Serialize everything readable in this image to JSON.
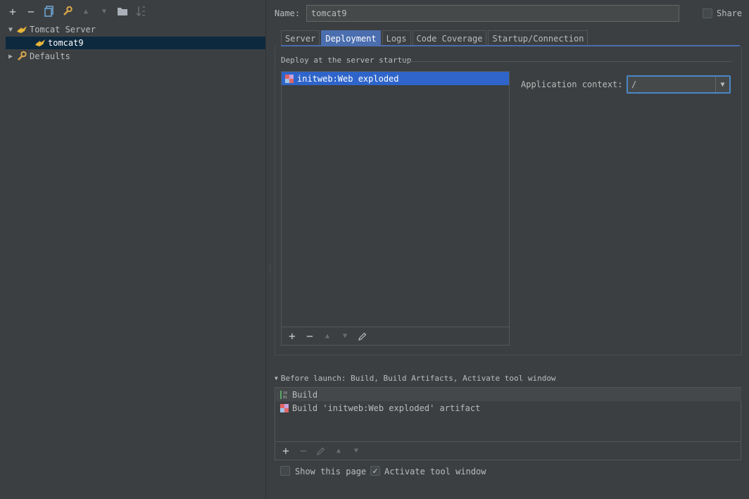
{
  "toolbar": {
    "add": "+",
    "remove": "−",
    "up": "▲",
    "down": "▼"
  },
  "tree": {
    "items": [
      {
        "label": "Tomcat Server",
        "icon": "tomcat-icon",
        "expanded": true
      },
      {
        "label": "tomcat9",
        "icon": "tomcat-icon",
        "selected": true
      },
      {
        "label": "Defaults",
        "icon": "wrench-icon",
        "expanded": false
      }
    ]
  },
  "config": {
    "name_label": "Name:",
    "name_value": "tomcat9",
    "share_label": "Share"
  },
  "tabs": [
    {
      "label": "Server"
    },
    {
      "label": "Deployment",
      "active": true
    },
    {
      "label": "Logs"
    },
    {
      "label": "Code Coverage"
    },
    {
      "label": "Startup/Connection"
    }
  ],
  "deployment": {
    "legend": "Deploy at the server startup",
    "items": [
      "initweb:Web exploded"
    ],
    "app_context_label": "Application context:",
    "app_context_value": "/"
  },
  "before_launch": {
    "title": "Before launch: Build, Build Artifacts, Activate tool window",
    "items": [
      "Build",
      "Build 'initweb:Web exploded' artifact"
    ]
  },
  "options": {
    "show_page_label": "Show this page",
    "show_page_checked": false,
    "activate_label": "Activate tool window",
    "activate_checked": true
  },
  "colors": {
    "accent": "#4b6eaf",
    "selection": "#2f65ca",
    "background": "#3c3f41"
  }
}
